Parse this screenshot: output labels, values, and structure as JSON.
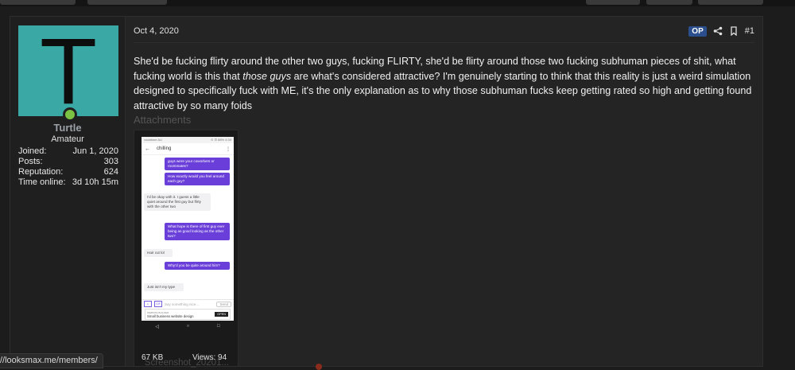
{
  "user": {
    "avatar_letter": "T",
    "name": "Turtle",
    "title": "Amateur",
    "stats": [
      {
        "label": "Joined:",
        "value": "Jun 1, 2020"
      },
      {
        "label": "Posts:",
        "value": "303"
      },
      {
        "label": "Reputation:",
        "value": "624"
      },
      {
        "label": "Time online:",
        "value": "3d 10h 15m"
      }
    ]
  },
  "post": {
    "date": "Oct 4, 2020",
    "op_badge": "OP",
    "number": "#1",
    "message_before_em": "She'd be fucking flirty around the other two guys, fucking FLIRTY, she'd be flirty around those two fucking subhuman pieces of shit, what fucking world is this that ",
    "message_em": "those guys",
    "message_after_em": " are what's considered attractive? I'm genuinely starting to think that this reality is just a weird simulation designed to specifically fuck with ME, it's the only explanation as to why those subhuman fucks keep getting rated so high and getting found attractive by so many foids"
  },
  "attachments": {
    "heading": "Attachments",
    "items": [
      {
        "name": "Screenshot_20201...",
        "size": "67 KB",
        "views": "Views: 94",
        "thumbnail": {
          "status_left": "vodafone AU",
          "status_right": "⊙ ⊡ 88% 4:34",
          "chat_title": "chilling",
          "bubbles": [
            {
              "from": "me",
              "text": "guys were your coworkers or roommates?"
            },
            {
              "from": "me",
              "text": "How exactly would you feel around each guy?"
            },
            {
              "from": "them",
              "text": "I'd be okay with it. I guess a little quiet around the first guy but flirty with the other two"
            },
            {
              "from": "me",
              "text": "What hope is there of first guy ever being as good looking as the other two?"
            },
            {
              "from": "them",
              "text": "Hair cut lol"
            },
            {
              "from": "me",
              "text": "Why'd you be quite around him?"
            },
            {
              "from": "them",
              "text": "Just isn't my type"
            }
          ],
          "input_placeholder": "Say something nice...",
          "input_icon_label": "GIF",
          "send_label": "Send",
          "ad_small": "WEBSITE BUILDER",
          "ad_text": "Small business website design",
          "ad_button": "OPEN"
        }
      }
    ]
  },
  "status_url": "//looksmax.me/members/",
  "colors": {
    "background": "#1c1c1c",
    "avatar_bg": "#3aa8a4",
    "username": "#9aa0a6",
    "online": "#7ac144",
    "op_badge": "#2b4e8c",
    "bubble_me": "#6a3fd9"
  }
}
